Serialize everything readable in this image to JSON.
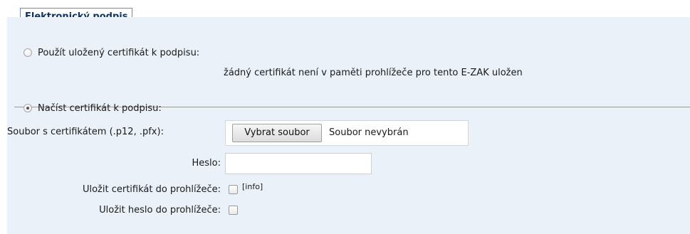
{
  "section": {
    "legend": "Elektronický podpis"
  },
  "stored_cert": {
    "label": "Použít uložený certifikát k podpisu:",
    "status": "žádný certifikát není v paměti prohlížeče pro tento E-ZAK uložen",
    "selected": false
  },
  "load_cert": {
    "label": "Načíst certifikát k podpisu:",
    "selected": true,
    "file_label": "Soubor s certifikátem (.p12, .pfx):",
    "file_button": "Vybrat soubor",
    "file_status": "Soubor nevybrán",
    "password_label": "Heslo:",
    "password_value": "",
    "save_cert_label": "Uložit certifikát do prohlížeče:",
    "save_cert_checked": false,
    "info_link": "[info]",
    "save_password_label": "Uložit heslo do prohlížeče:",
    "save_password_checked": false
  },
  "colors": {
    "panel_bg": "#eaf1f8",
    "legend_text": "#0c3566",
    "legend_border": "#6f8fb0"
  }
}
